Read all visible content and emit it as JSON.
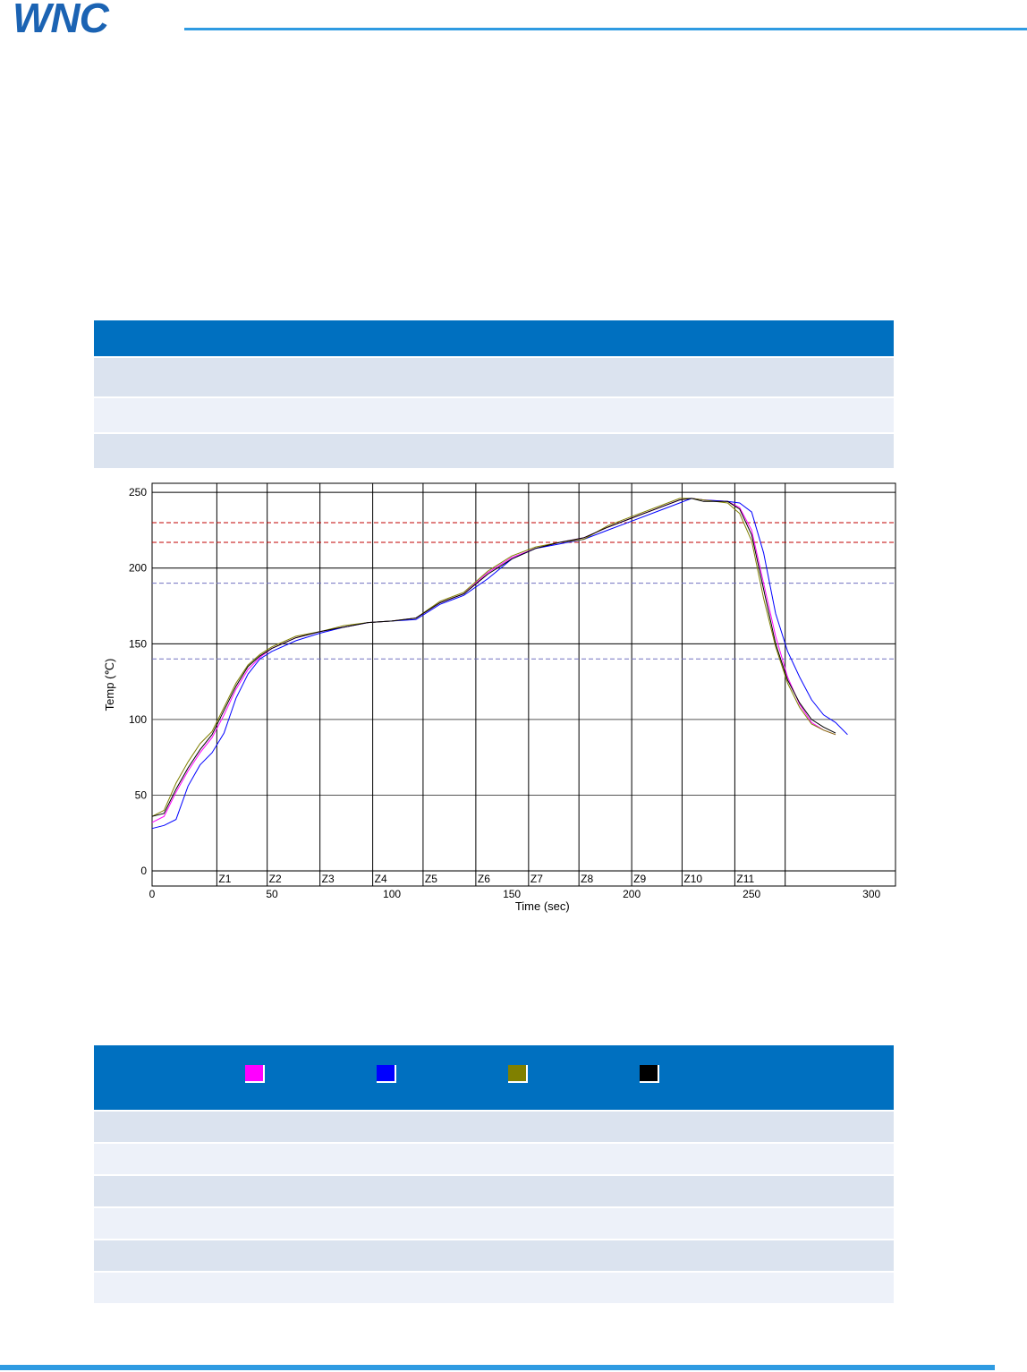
{
  "header": {
    "logo_text": "WNC"
  },
  "legend": {
    "colors": [
      "#ff00ff",
      "#0000ff",
      "#808000",
      "#000000"
    ]
  },
  "chart_data": {
    "type": "line",
    "xlabel": "Time (sec)",
    "ylabel": "Temp (℃)",
    "xlim": [
      0,
      310
    ],
    "ylim": [
      -10,
      256
    ],
    "x_ticks": [
      0,
      50,
      100,
      150,
      200,
      250,
      300
    ],
    "y_ticks": [
      0,
      50,
      100,
      150,
      200,
      250
    ],
    "grid": true,
    "zones": [
      {
        "label": "Z1",
        "start": 27
      },
      {
        "label": "Z2",
        "start": 48
      },
      {
        "label": "Z3",
        "start": 70
      },
      {
        "label": "Z4",
        "start": 92
      },
      {
        "label": "Z5",
        "start": 113
      },
      {
        "label": "Z6",
        "start": 135
      },
      {
        "label": "Z7",
        "start": 157
      },
      {
        "label": "Z8",
        "start": 178
      },
      {
        "label": "Z9",
        "start": 200
      },
      {
        "label": "Z10",
        "start": 221
      },
      {
        "label": "Z11",
        "start": 243
      }
    ],
    "zone_end": 264,
    "reference_lines": [
      {
        "y": 230,
        "color": "#c00000"
      },
      {
        "y": 217,
        "color": "#c00000"
      },
      {
        "y": 190,
        "color": "#7070c0"
      },
      {
        "y": 140,
        "color": "#7070c0"
      }
    ],
    "series": [
      {
        "color": "#ff00ff",
        "x": [
          0,
          5,
          10,
          15,
          20,
          25,
          30,
          35,
          40,
          45,
          50,
          60,
          70,
          80,
          90,
          100,
          110,
          120,
          130,
          140,
          150,
          160,
          170,
          180,
          190,
          200,
          210,
          220,
          225,
          230,
          240,
          245,
          250,
          255,
          260,
          265,
          270,
          275,
          280,
          285
        ],
        "y": [
          32,
          36,
          52,
          66,
          78,
          88,
          103,
          120,
          133,
          141,
          147,
          154,
          158,
          161,
          164,
          165,
          167,
          177,
          183,
          197,
          207,
          213,
          217,
          220,
          227,
          233,
          239,
          245,
          246,
          245,
          244,
          240,
          225,
          190,
          155,
          128,
          110,
          98,
          93,
          90
        ]
      },
      {
        "color": "#0000ff",
        "x": [
          0,
          5,
          10,
          15,
          20,
          25,
          30,
          35,
          40,
          45,
          50,
          60,
          70,
          80,
          90,
          100,
          110,
          120,
          130,
          140,
          150,
          160,
          170,
          180,
          190,
          200,
          210,
          220,
          225,
          230,
          240,
          245,
          250,
          255,
          260,
          265,
          270,
          275,
          280,
          285,
          290
        ],
        "y": [
          28,
          30,
          34,
          56,
          70,
          78,
          91,
          114,
          130,
          140,
          145,
          152,
          157,
          161,
          164,
          165,
          166,
          176,
          182,
          193,
          206,
          213,
          216,
          219,
          225,
          231,
          237,
          243,
          246,
          245,
          244,
          243,
          237,
          210,
          170,
          145,
          128,
          113,
          103,
          98,
          90
        ]
      },
      {
        "color": "#808000",
        "x": [
          0,
          5,
          10,
          15,
          20,
          25,
          30,
          35,
          40,
          45,
          50,
          60,
          70,
          80,
          90,
          100,
          110,
          120,
          130,
          140,
          150,
          160,
          170,
          180,
          190,
          200,
          210,
          220,
          225,
          230,
          240,
          245,
          250,
          255,
          260,
          265,
          270,
          275,
          280,
          285
        ],
        "y": [
          36,
          40,
          58,
          72,
          84,
          92,
          108,
          124,
          136,
          143,
          148,
          155,
          158,
          162,
          164,
          165,
          167,
          178,
          184,
          198,
          208,
          214,
          217,
          219,
          228,
          234,
          240,
          246,
          246,
          245,
          243,
          236,
          218,
          180,
          148,
          124,
          108,
          97,
          93,
          90
        ]
      },
      {
        "color": "#000000",
        "x": [
          0,
          5,
          10,
          15,
          20,
          25,
          30,
          35,
          40,
          45,
          50,
          60,
          70,
          80,
          90,
          100,
          110,
          120,
          130,
          140,
          150,
          160,
          170,
          180,
          190,
          200,
          210,
          220,
          225,
          230,
          240,
          245,
          250,
          255,
          260,
          265,
          270,
          275,
          280,
          285
        ],
        "y": [
          36,
          38,
          54,
          68,
          80,
          90,
          106,
          122,
          135,
          142,
          147,
          154,
          158,
          161,
          164,
          165,
          167,
          177,
          183,
          196,
          206,
          213,
          217,
          220,
          227,
          233,
          239,
          245,
          246,
          244,
          244,
          239,
          222,
          186,
          150,
          126,
          111,
          100,
          95,
          91
        ]
      }
    ]
  }
}
